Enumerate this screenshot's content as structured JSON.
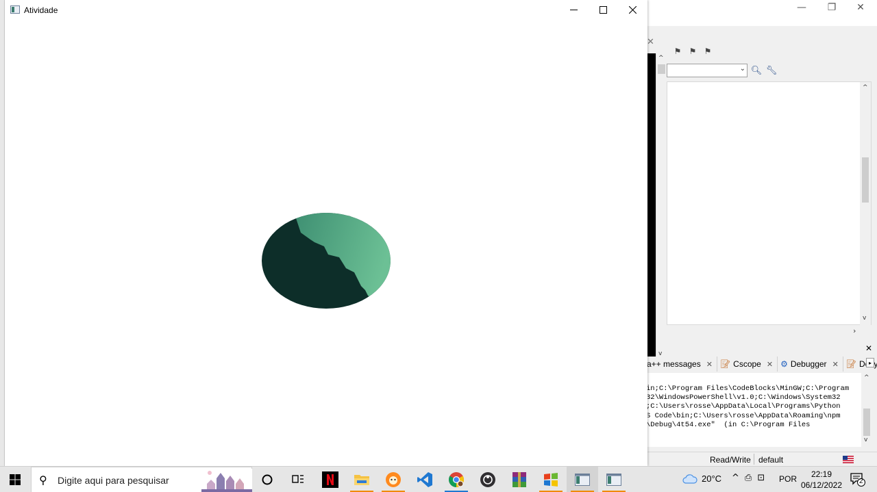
{
  "app_window": {
    "title": "Atividade",
    "controls": {
      "minimize": "—",
      "maximize": "☐",
      "close": "✕"
    },
    "shape_colors": {
      "dark": "#0d2e29",
      "light": "#6cc095",
      "mid": "#3e8f72"
    }
  },
  "ide": {
    "log_tabs": [
      {
        "label": "a++ messages",
        "icon": "",
        "close": "✕"
      },
      {
        "label": "Cscope",
        "icon": "pencil-icon",
        "close": "✕"
      },
      {
        "label": "Debugger",
        "icon": "gear-icon",
        "close": "✕"
      },
      {
        "label": "Doxyb",
        "icon": "pencil-icon",
        "close": ""
      }
    ],
    "log_lines": [
      "in;C:\\Program Files\\CodeBlocks\\MinGW;C:\\Program",
      "32\\WindowsPowerShell\\v1.0;C:\\Windows\\System32",
      ";C:\\Users\\rosse\\AppData\\Local\\Programs\\Python",
      "S Code\\bin;C:\\Users\\rosse\\AppData\\Roaming\\npm",
      "\\Debug\\4t54.exe\"  (in C:\\Program Files"
    ],
    "status": {
      "read_write": "Read/Write",
      "encoding": "default"
    }
  },
  "taskbar": {
    "search_placeholder": "Digite aqui para pesquisar",
    "weather": "20°C",
    "language": "POR",
    "time": "22:19",
    "date": "06/12/2022",
    "notification_count": "2",
    "apps": [
      "task-view",
      "netflix",
      "file-explorer",
      "browser-fox",
      "vscode",
      "chrome",
      "obs",
      "winrar",
      "windows-logo",
      "codeblocks-window-1",
      "codeblocks-window-2"
    ]
  }
}
